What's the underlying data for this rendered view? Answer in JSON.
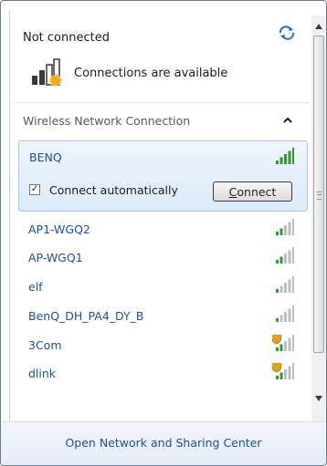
{
  "status": {
    "title": "Not connected",
    "availability": "Connections are available"
  },
  "section": {
    "title": "Wireless Network Connection"
  },
  "selected": {
    "name": "BENQ",
    "connect_auto_label": "Connect automatically",
    "connect_auto_checked": true,
    "check_glyph": "✓",
    "connect_button_label_underlined": "C",
    "connect_button_label_rest": "onnect",
    "signal_bars": 5
  },
  "networks": [
    {
      "name": "AP1-WGQ2",
      "signal_bars": 2,
      "security_shield": false
    },
    {
      "name": "AP-WGQ1",
      "signal_bars": 2,
      "security_shield": false
    },
    {
      "name": "elf",
      "signal_bars": 1,
      "security_shield": false
    },
    {
      "name": "BenQ_DH_PA4_DY_B",
      "signal_bars": 1,
      "security_shield": false
    },
    {
      "name": "3Com",
      "signal_bars": 2,
      "security_shield": true
    },
    {
      "name": "dlink",
      "signal_bars": 2,
      "security_shield": true
    }
  ],
  "footer": {
    "link": "Open Network and Sharing Center"
  },
  "colors": {
    "link_blue": "#1d4fa3",
    "signal_green": "#2e9a2e",
    "signal_gray": "#b9bec4",
    "shield_gold": "#e0a21b"
  }
}
